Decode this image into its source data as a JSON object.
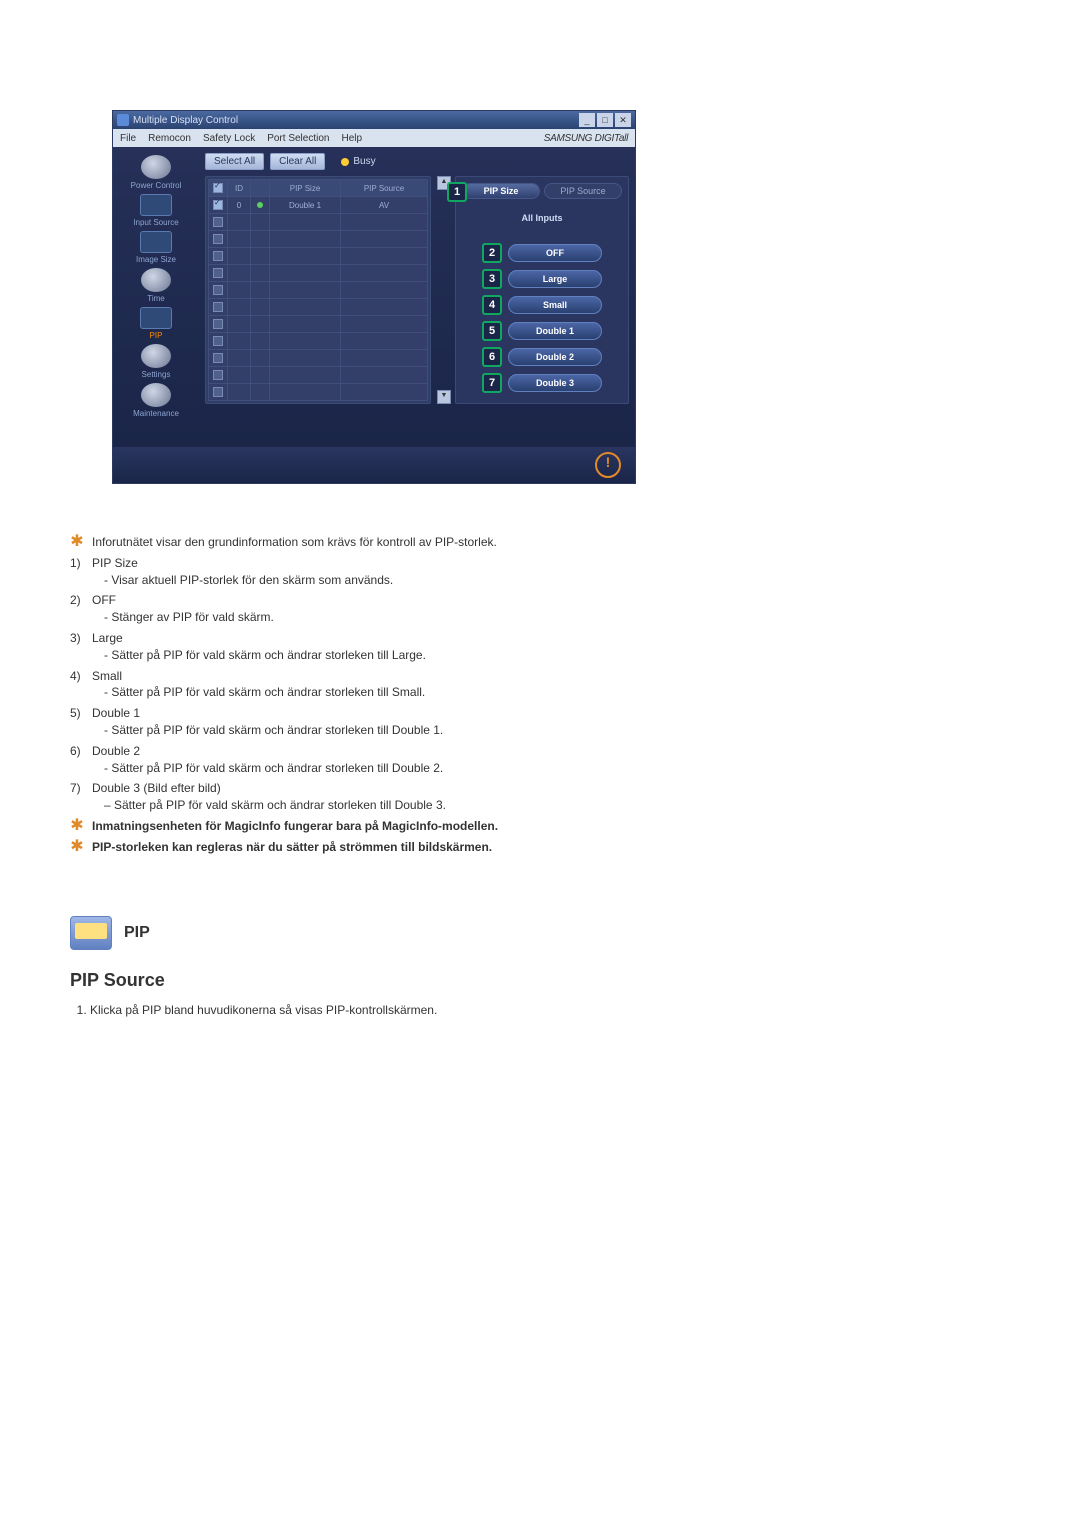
{
  "window": {
    "title": "Multiple Display Control",
    "menu": [
      "File",
      "Remocon",
      "Safety Lock",
      "Port Selection",
      "Help"
    ],
    "brand": "SAMSUNG DIGITall"
  },
  "sidebar": {
    "items": [
      {
        "label": "Power Control"
      },
      {
        "label": "Input Source"
      },
      {
        "label": "Image Size"
      },
      {
        "label": "Time"
      },
      {
        "label": "PIP",
        "active": true
      },
      {
        "label": "Settings"
      },
      {
        "label": "Maintenance"
      }
    ]
  },
  "toolbar": {
    "select_all": "Select All",
    "clear_all": "Clear All",
    "busy": "Busy"
  },
  "grid": {
    "headers": {
      "chk": "✓",
      "id": "ID",
      "status": "",
      "pip_size": "PIP Size",
      "pip_source": "PIP Source"
    },
    "rows": [
      {
        "checked": true,
        "id": "0",
        "status": "green",
        "pip_size": "Double 1",
        "pip_source": "AV"
      }
    ],
    "empty_row_count": 11
  },
  "options": {
    "tabs": {
      "size": "PIP Size",
      "source": "PIP Source"
    },
    "callout1": "1",
    "all_inputs": "All Inputs",
    "items": [
      {
        "num": "2",
        "label": "OFF"
      },
      {
        "num": "3",
        "label": "Large"
      },
      {
        "num": "4",
        "label": "Small"
      },
      {
        "num": "5",
        "label": "Double 1"
      },
      {
        "num": "6",
        "label": "Double 2"
      },
      {
        "num": "7",
        "label": "Double 3"
      }
    ]
  },
  "body_text": {
    "intro": "Inforutnätet visar den grundinformation som krävs för kontroll av PIP-storlek.",
    "list": [
      {
        "num": "1)",
        "title": "PIP Size",
        "desc": "- Visar aktuell PIP-storlek för den skärm som används."
      },
      {
        "num": "2)",
        "title": "OFF",
        "desc": "- Stänger av PIP för vald skärm."
      },
      {
        "num": "3)",
        "title": "Large",
        "desc": "- Sätter på PIP för vald skärm och ändrar storleken till Large."
      },
      {
        "num": "4)",
        "title": "Small",
        "desc": "- Sätter på PIP för vald skärm och ändrar storleken till Small."
      },
      {
        "num": "5)",
        "title": "Double 1",
        "desc": "- Sätter på PIP för vald skärm och ändrar storleken till Double 1."
      },
      {
        "num": "6)",
        "title": "Double 2",
        "desc": "- Sätter på PIP för vald skärm och ändrar storleken till Double 2."
      },
      {
        "num": "7)",
        "title": "Double 3 (Bild efter bild)",
        "desc": "– Sätter på PIP för vald skärm och ändrar storleken till Double 3."
      }
    ],
    "note1": "Inmatningsenheten för MagicInfo fungerar bara på MagicInfo-modellen.",
    "note2": "PIP-storleken kan regleras när du sätter på strömmen till bildskärmen."
  },
  "section2": {
    "title": "PIP",
    "heading": "PIP Source",
    "instr1": "Klicka på PIP bland huvudikonerna så visas PIP-kontrollskärmen."
  }
}
